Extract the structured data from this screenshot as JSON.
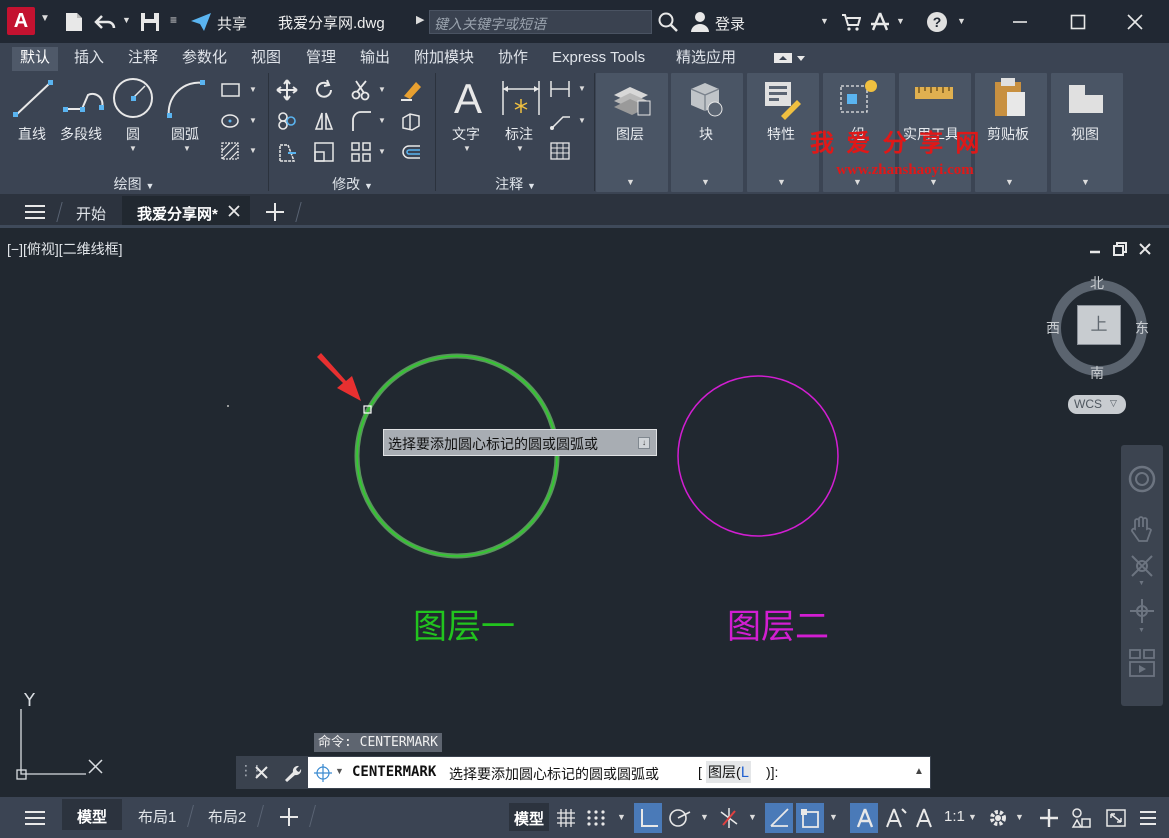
{
  "titlebar": {
    "app_letter": "A",
    "share_label": "共享",
    "file_title": "我爱分享网.dwg",
    "search_placeholder": "键入关键字或短语",
    "login_label": "登录"
  },
  "ribbon_tabs": [
    "默认",
    "插入",
    "注释",
    "参数化",
    "视图",
    "管理",
    "输出",
    "附加模块",
    "协作",
    "Express Tools",
    "精选应用"
  ],
  "ribbon": {
    "draw": {
      "title": "绘图",
      "line": "直线",
      "polyline": "多段线",
      "circle": "圆",
      "arc": "圆弧"
    },
    "modify": {
      "title": "修改"
    },
    "annotation": {
      "title": "注释",
      "text": "文字",
      "dimension": "标注"
    },
    "layer": "图层",
    "block": "块",
    "properties": "特性",
    "group": "组",
    "utilities": "实用工具",
    "clipboard": "剪贴板",
    "view": "视图"
  },
  "watermark": {
    "title": "我 爱 分 享 网",
    "url": "www.zhanshaoyi.com"
  },
  "doc_tabs": {
    "start": "开始",
    "current": "我爱分享网*"
  },
  "viewport": {
    "label": "[−][俯视][二维线框]",
    "viewcube": {
      "north": "北",
      "south": "南",
      "east": "东",
      "west": "西",
      "top": "上",
      "wcs": "WCS"
    },
    "ucs": {
      "y": "Y",
      "x": "X"
    }
  },
  "drawing": {
    "tooltip": "选择要添加圆心标记的圆或圆弧或",
    "layer1_label": "图层一",
    "layer2_label": "图层二",
    "layer1_color": "#22c41e",
    "layer2_color": "#d21ed2"
  },
  "command": {
    "history": "命令: CENTERMARK",
    "cmd_name": "CENTERMARK",
    "prompt": "选择要添加圆心标记的圆或圆弧或",
    "option_open": "[",
    "option": "图层(",
    "option_key": "L",
    "option_close": ")]:"
  },
  "status": {
    "model_tab": "模型",
    "layout1": "布局1",
    "layout2": "布局2",
    "model_btn": "模型",
    "scale": "1:1"
  }
}
